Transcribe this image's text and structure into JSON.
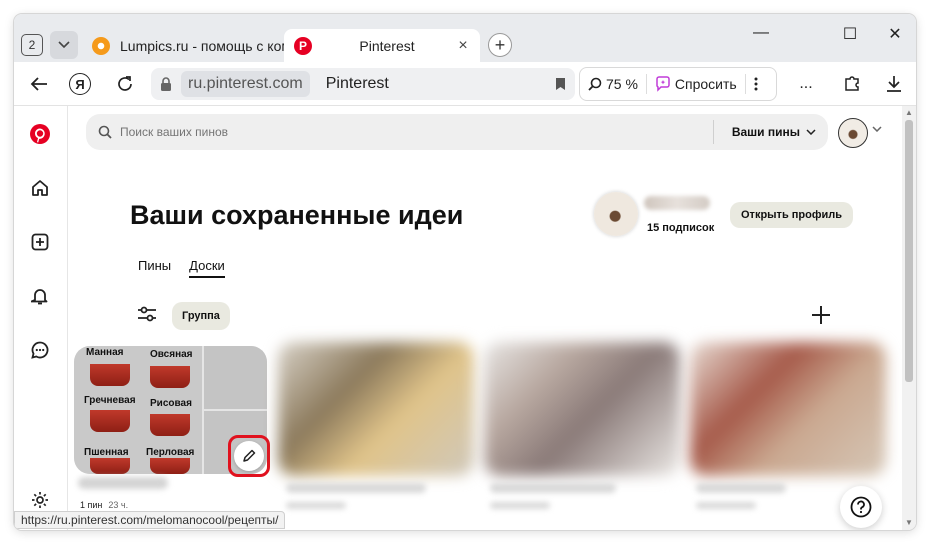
{
  "browser": {
    "tab_count": "2",
    "tabs": [
      {
        "title": "Lumpics.ru - помощь с ком"
      },
      {
        "title": "Pinterest",
        "close": "×"
      }
    ],
    "new_tab": "+",
    "window_controls": {
      "minimize": "—",
      "maximize": "☐",
      "close": "✕"
    },
    "yandex_letter": "Я",
    "url": "ru.pinterest.com",
    "page_title": "Pinterest",
    "zoom": "75 %",
    "ask_label": "Спросить",
    "more_dots": "...",
    "status_url": "https://ru.pinterest.com/melomanocool/рецепты/"
  },
  "pinterest": {
    "search_placeholder": "Поиск ваших пинов",
    "your_pins": "Ваши пины",
    "heading": "Ваши сохраненные идеи",
    "subscriptions": "15 подписок",
    "open_profile": "Открыть профиль",
    "tabs": [
      "Пины",
      "Доски"
    ],
    "group_chip": "Группа",
    "board1": {
      "grains": [
        "Манная",
        "Овсяная",
        "Гречневая",
        "Рисовая",
        "Пшенная",
        "Перловая"
      ],
      "pins": "1 пин",
      "time": "23 ч."
    }
  },
  "colors": {
    "pinterest_red": "#e60023",
    "highlight_red": "#e1111e",
    "chip_bg": "#e9e9e0"
  }
}
